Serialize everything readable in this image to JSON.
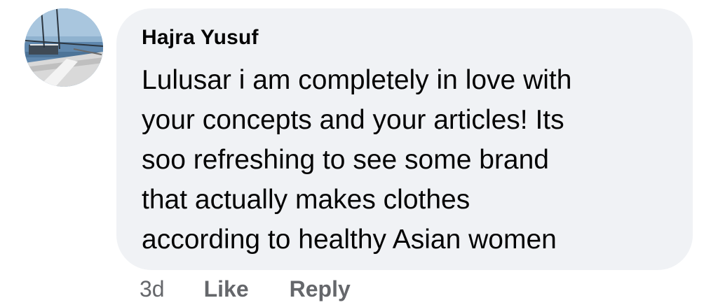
{
  "comment": {
    "author": "Hajra Yusuf",
    "text_lines": [
      "Lulusar i am completely in love with",
      "your concepts and your articles! Its",
      "soo refreshing to see some brand",
      "that actually makes clothes",
      "according to healthy Asian women"
    ],
    "timestamp": "3d",
    "like_label": "Like",
    "reply_label": "Reply"
  },
  "colors": {
    "bubble_bg": "#f0f2f5",
    "text": "#050505",
    "secondary_text": "#65676b"
  },
  "icons": {
    "avatar": "profile-photo"
  }
}
